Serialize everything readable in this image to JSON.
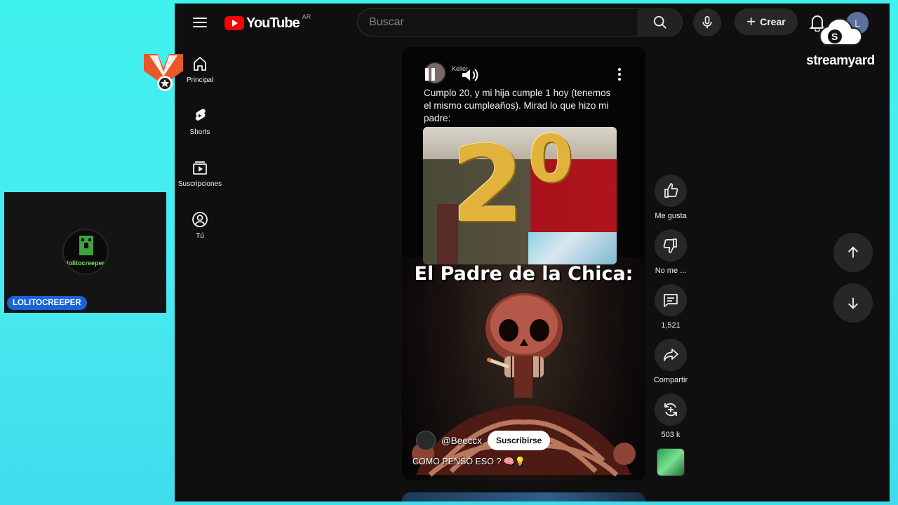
{
  "header": {
    "logo_text": "YouTube",
    "country_code": "AR",
    "search_placeholder": "Buscar",
    "create_label": "Crear",
    "avatar_initial": "L"
  },
  "sidebar": {
    "items": [
      {
        "label": "Principal",
        "icon": "home-icon"
      },
      {
        "label": "Shorts",
        "icon": "shorts-icon"
      },
      {
        "label": "Suscripciones",
        "icon": "subscriptions-icon"
      },
      {
        "label": "Tú",
        "icon": "you-icon"
      }
    ]
  },
  "short": {
    "post_author": "Keller",
    "post_text": "Cumplo 20, y mi hija cumple 1 hoy (tenemos el mismo cumpleaños). Mirad lo que hizo mi padre:",
    "balloon_digit_1": "2",
    "balloon_digit_2": "0",
    "headline": "El Padre de la Chica:",
    "channel_handle": "@Beeccx",
    "subscribe_label": "Suscribirse",
    "caption": "COMO PENSÓ ESO ? 🧠💡"
  },
  "actions": {
    "like_label": "Me gusta",
    "dislike_label": "No me ...",
    "comments_count": "1,521",
    "share_label": "Compartir",
    "remix_count": "503 k"
  },
  "overlay": {
    "streamyard_text": "streamyard",
    "cam_avatar_text": "lolitocreeper",
    "cam_name": "LOLITOCREEPER"
  },
  "colors": {
    "background_gradient": "#3ff2ee",
    "youtube_red": "#ff0000",
    "surface": "#0f0f0f",
    "button_bg": "#272727",
    "name_tag": "#1863d6"
  }
}
